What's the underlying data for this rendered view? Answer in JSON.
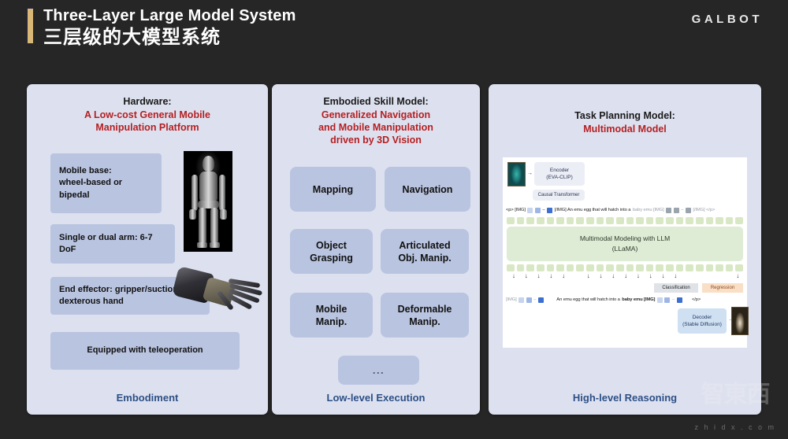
{
  "header": {
    "title_en": "Three-Layer Large Model System",
    "title_cn": "三层级的大模型系统",
    "brand": "GALBOT"
  },
  "panels": {
    "hardware": {
      "head_black": "Hardware:",
      "head_red_line1": "A Low-cost General Mobile",
      "head_red_line2": "Manipulation Platform",
      "boxes": [
        "Mobile base:\nwheel-based or\nbipedal",
        "Single or dual arm: 6-7 DoF",
        "End effector: gripper/suction cup/ dexterous hand",
        "Equipped with teleoperation"
      ],
      "footer": "Embodiment"
    },
    "skill": {
      "head_black": "Embodied Skill Model:",
      "head_red_line1": "Generalized Navigation",
      "head_red_line2": "and Mobile Manipulation",
      "head_red_line3": "driven by 3D Vision",
      "pills": [
        "Mapping",
        "Navigation",
        "Object\nGrasping",
        "Articulated\nObj. Manip.",
        "Mobile\nManip.",
        "Deformable\nManip.",
        "..."
      ],
      "footer": "Low-level Execution"
    },
    "task": {
      "head_black": "Task Planning Model:",
      "head_red": "Multimodal Model",
      "footer": "High-level Reasoning",
      "diagram": {
        "encoder_line1": "Encoder",
        "encoder_line2": "(EVA-CLIP)",
        "causal_transformer": "Causal Transformer",
        "llm_line1": "Multimodal Modeling with LLM",
        "llm_line2": "(LLaMA)",
        "classification": "Classification",
        "regression": "Regression",
        "decoder_line1": "Decoder",
        "decoder_line2": "(Stable Diffusion)",
        "seq_top_prefix": "<p> [IMG]",
        "seq_top_mid": "[/IMG] An emu egg  that  will  hatch  into a",
        "seq_top_dim": "baby emu [IMG]",
        "seq_top_suffix": "[/IMG] </p>",
        "seq_bot_prefix": "[IMG]",
        "seq_bot_mid": "An  emu egg  that will hatch into  a",
        "seq_bot_bold": "baby emu [IMG]",
        "seq_bot_end": "</p>",
        "dash": "–"
      }
    }
  },
  "watermark": {
    "cn": "智東西",
    "url": "z h i d x . c o m"
  },
  "colors": {
    "slide_bg": "#262626",
    "panel_bg": "#dde1ef",
    "box_bg": "#b9c4e0",
    "accent_gold": "#d8b777",
    "red": "#b51f22",
    "footer_blue": "#2d4f86",
    "llm_green": "#dfecd5"
  }
}
